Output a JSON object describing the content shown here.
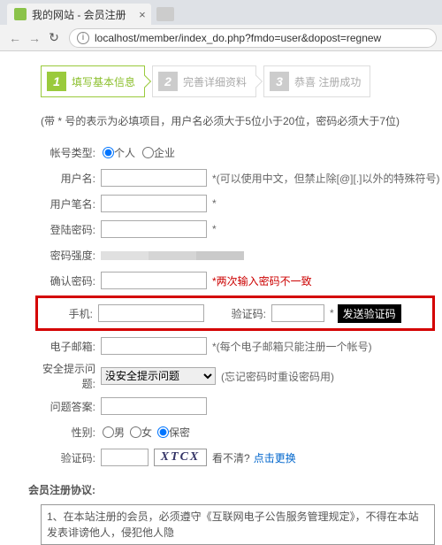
{
  "browser": {
    "tab_title": "我的网站 - 会员注册",
    "url": "localhost/member/index_do.php?fmdo=user&dopost=regnew"
  },
  "steps": [
    {
      "num": "1",
      "label": "填写基本信息",
      "active": true
    },
    {
      "num": "2",
      "label": "完善详细资料",
      "active": false
    },
    {
      "num": "3",
      "label": "恭喜 注册成功",
      "active": false
    }
  ],
  "note": "(带 * 号的表示为必填项目，用户名必须大于5位小于20位，密码必须大于7位)",
  "form": {
    "acct_type_label": "帐号类型:",
    "acct_personal": "个人",
    "acct_company": "企业",
    "username_label": "用户名:",
    "username_hint": "*(可以使用中文，但禁止除[@][.]以外的特殊符号)",
    "nickname_label": "用户笔名:",
    "nickname_hint": "*",
    "pwd_label": "登陆密码:",
    "pwd_hint": "*",
    "strength_label": "密码强度:",
    "confirm_label": "确认密码:",
    "confirm_hint": "*两次输入密码不一致",
    "phone_label": "手机:",
    "vcode_label": "验证码:",
    "vcode_star": "*",
    "send_btn": "发送验证码",
    "email_label": "电子邮箱:",
    "email_hint": "*(每个电子邮箱只能注册一个帐号)",
    "question_label": "安全提示问题:",
    "question_sel": "没安全提示问题",
    "question_hint": "(忘记密码时重设密码用)",
    "answer_label": "问题答案:",
    "gender_label": "性别:",
    "gender_m": "男",
    "gender_f": "女",
    "gender_s": "保密",
    "captcha_label": "验证码:",
    "captcha_img": "XTCX",
    "captcha_q": "看不清?",
    "captcha_link": "点击更换",
    "agree_label": "会员注册协议:",
    "agree_text": "1、在本站注册的会员，必须遵守《互联网电子公告服务管理规定》，不得在本站发表诽谤他人，侵犯他人隐"
  }
}
